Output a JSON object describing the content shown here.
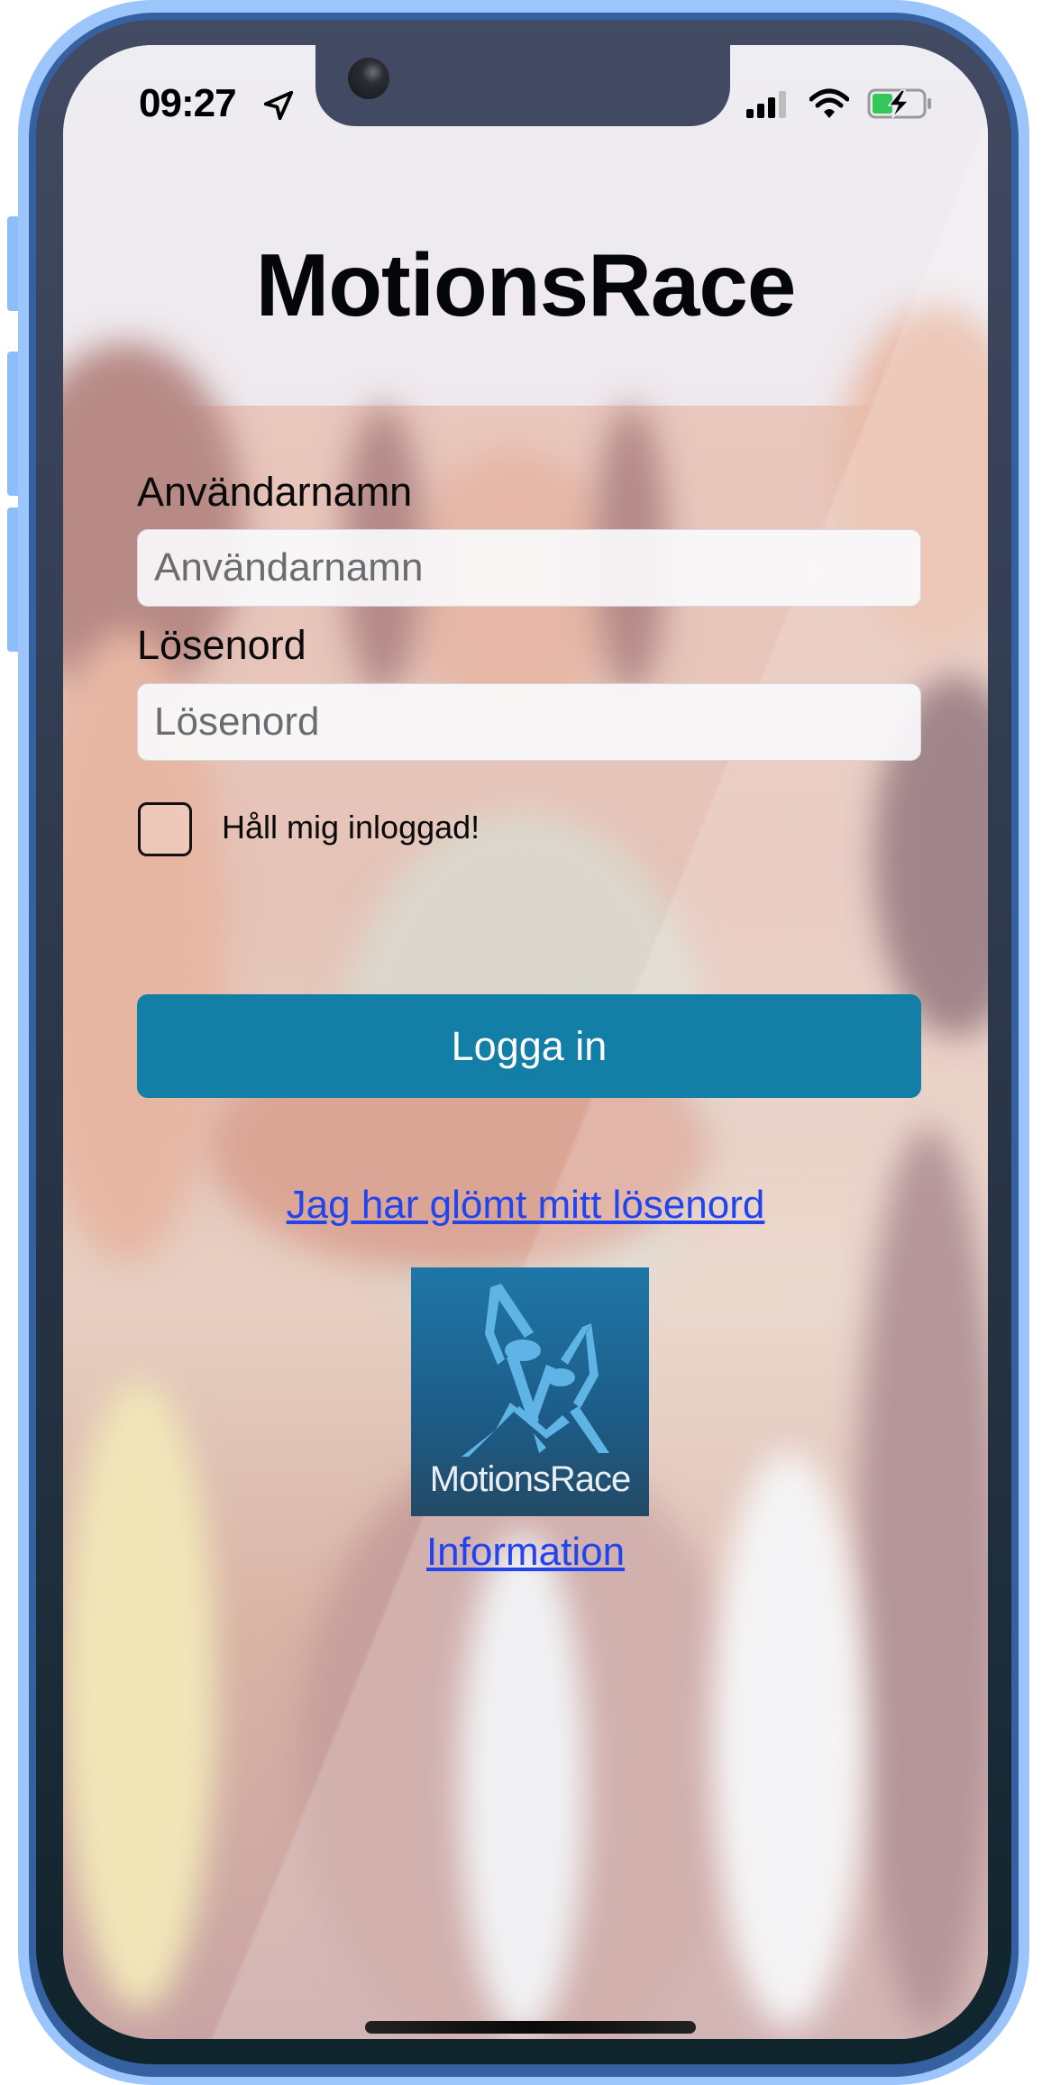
{
  "status_bar": {
    "time": "09:27",
    "location_icon": "location-arrow-icon",
    "signal_icon": "cellular-signal-icon",
    "wifi_icon": "wifi-icon",
    "battery_icon": "battery-charging-icon",
    "battery_color": "#34c759"
  },
  "app": {
    "title": "MotionsRace"
  },
  "form": {
    "username_label": "Användarnamn",
    "username_placeholder": "Användarnamn",
    "username_value": "",
    "password_label": "Lösenord",
    "password_placeholder": "Lösenord",
    "password_value": "",
    "remember_label": "Håll mig inloggad!",
    "remember_checked": false,
    "login_label": "Logga in",
    "login_color": "#137ea6"
  },
  "links": {
    "forgot_password": "Jag har glömt mitt lösenord",
    "information": "Information",
    "link_color": "#2244ee"
  },
  "logo": {
    "text": "MotionsRace"
  }
}
